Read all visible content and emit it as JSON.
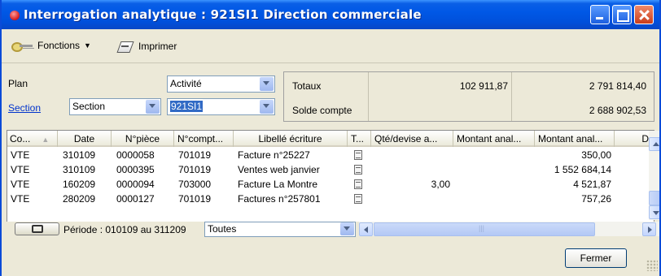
{
  "window": {
    "title": "Interrogation analytique : 921SI1 Direction commerciale"
  },
  "toolbar": {
    "fonctions_label": "Fonctions",
    "imprimer_label": "Imprimer"
  },
  "filters": {
    "plan_label": "Plan",
    "plan_value": "Activité",
    "section_link": "Section",
    "section_type_value": "Section",
    "section_value": "921SI1"
  },
  "totals": {
    "totaux_label": "Totaux",
    "totaux_value1": "102 911,87",
    "totaux_value2": "2 791 814,40",
    "solde_label": "Solde compte",
    "solde_value": "2 688 902,53"
  },
  "grid": {
    "columns": [
      "Co...",
      "Date",
      "N°pièce",
      "N°compt...",
      "Libellé écriture",
      "T...",
      "Qté/devise a...",
      "Montant anal...",
      "Montant anal...",
      "D"
    ],
    "rows": [
      {
        "code": "VTE",
        "date": "310109",
        "piece": "0000058",
        "compte": "701019",
        "libelle": "Facture n°25227",
        "qte": "",
        "montant1": "",
        "montant2": "350,00"
      },
      {
        "code": "VTE",
        "date": "310109",
        "piece": "0000395",
        "compte": "701019",
        "libelle": "Ventes web janvier",
        "qte": "",
        "montant1": "",
        "montant2": "1 552 684,14"
      },
      {
        "code": "VTE",
        "date": "160209",
        "piece": "0000094",
        "compte": "703000",
        "libelle": "Facture La Montre",
        "qte": "3,00",
        "montant1": "",
        "montant2": "4 521,87"
      },
      {
        "code": "VTE",
        "date": "280209",
        "piece": "0000127",
        "compte": "701019",
        "libelle": "Factures n°257801",
        "qte": "",
        "montant1": "",
        "montant2": "757,26"
      }
    ]
  },
  "status": {
    "period_text": "Période : 010109 au 311209",
    "filter_value": "Toutes"
  },
  "buttons": {
    "fermer_label": "Fermer"
  },
  "colors": {
    "titlebar": "#0058e6",
    "window_bg": "#ece9d8",
    "link": "#0033cc",
    "selection": "#316ac5"
  }
}
